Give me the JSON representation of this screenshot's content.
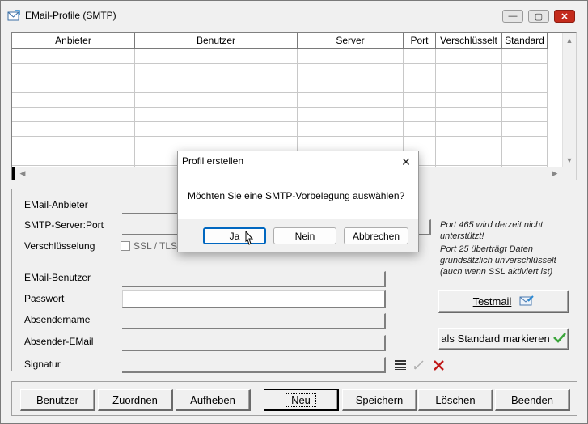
{
  "window": {
    "title": "EMail-Profile (SMTP)",
    "controls": {
      "minimize": "—",
      "maximize": "▢",
      "close": "✕"
    }
  },
  "grid": {
    "columns": [
      "Anbieter",
      "Benutzer",
      "Server",
      "Port",
      "Verschlüsselt",
      "Standard"
    ],
    "rows": []
  },
  "form": {
    "anbieter_label": "EMail-Anbieter",
    "server_label": "SMTP-Server:Port",
    "encryption_label": "Verschlüsselung",
    "ssl_label": "SSL / TLS",
    "ssl_checked": false,
    "user_label": "EMail-Benutzer",
    "password_label": "Passwort",
    "sender_name_label": "Absendername",
    "sender_email_label": "Absender-EMail",
    "signature_label": "Signatur",
    "port_note_1": "Port 465 wird derzeit nicht unterstützt!",
    "port_note_2": "Port 25 überträgt Daten grundsätzlich unverschlüsselt (auch wenn SSL aktiviert ist)",
    "testmail_label": "Testmail",
    "standard_label": "als Standard markieren"
  },
  "bottom_buttons": [
    {
      "label": "Benutzer"
    },
    {
      "label": "Zuordnen"
    },
    {
      "label": "Aufheben"
    },
    {
      "label": "Neu"
    },
    {
      "label": "Speichern"
    },
    {
      "label": "Löschen"
    },
    {
      "label": "Beenden"
    }
  ],
  "dialog": {
    "title": "Profil erstellen",
    "message": "Möchten Sie eine SMTP-Vorbelegung auswählen?",
    "yes_label": "Ja",
    "no_label": "Nein",
    "cancel_label": "Abbrechen",
    "close_glyph": "✕"
  },
  "colors": {
    "accent": "#0067c0",
    "close_red": "#c42b1c",
    "check_green": "#3aa53a",
    "delete_red": "#c01818"
  }
}
